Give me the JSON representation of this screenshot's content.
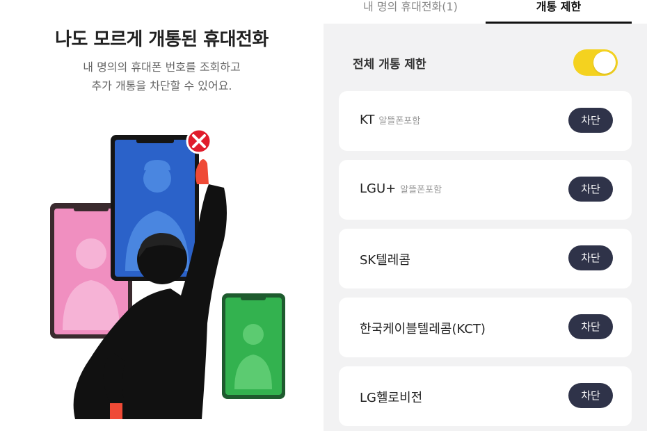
{
  "left_panel": {
    "headline": "나도 모르게 개통된 휴대전화",
    "subtitle_line1": "내 명의의 휴대폰 번호를 조회하고",
    "subtitle_line2": "추가 개통을 차단할 수 있어요."
  },
  "tabs": [
    {
      "label": "내 명의 휴대전화(1)",
      "active": false
    },
    {
      "label": "개통 제한",
      "active": true
    }
  ],
  "all_restriction": {
    "label": "전체 개통 제한",
    "toggle_on": true
  },
  "carriers": [
    {
      "name": "KT",
      "note": "알뜰폰포함",
      "button": "차단"
    },
    {
      "name": "LGU+",
      "note": "알뜰폰포함",
      "button": "차단"
    },
    {
      "name": "SK텔레콤",
      "note": "",
      "button": "차단"
    },
    {
      "name": "한국케이블텔레콤(KCT)",
      "note": "",
      "button": "차단"
    },
    {
      "name": "LG헬로비전",
      "note": "",
      "button": "차단"
    }
  ],
  "colors": {
    "toggle": "#f4d21f",
    "block_button": "#2f3349",
    "panel_bg": "#f2f2f3",
    "phone_blue": "#2b62c9",
    "phone_pink": "#f08fc0",
    "phone_green": "#33b24f",
    "alert_red": "#e01d2c"
  }
}
